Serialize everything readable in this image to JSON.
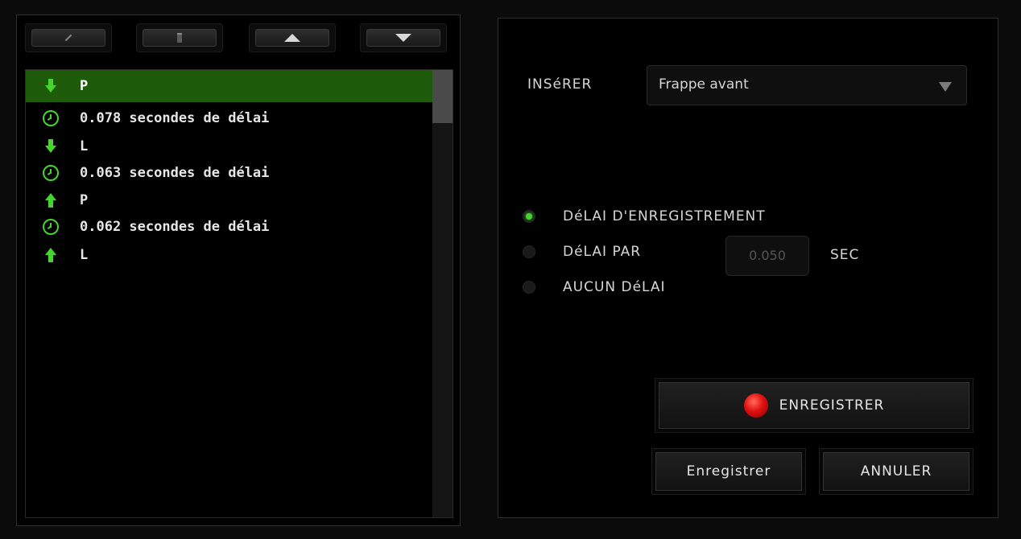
{
  "toolbar": {
    "buttons": [
      {
        "name": "edit",
        "icon": "pencil-icon"
      },
      {
        "name": "delete",
        "icon": "trash-icon"
      },
      {
        "name": "move-up",
        "icon": "arrow-up-icon"
      },
      {
        "name": "move-down",
        "icon": "arrow-down-icon"
      }
    ]
  },
  "macro_list": {
    "items": [
      {
        "icon": "key-down-arrow-icon",
        "text": "P",
        "selected": true
      },
      {
        "icon": "clock-icon",
        "text": "0.078 secondes de délai"
      },
      {
        "icon": "key-down-arrow-icon",
        "text": "L"
      },
      {
        "icon": "clock-icon",
        "text": "0.063 secondes de délai"
      },
      {
        "icon": "key-up-arrow-icon",
        "text": "P"
      },
      {
        "icon": "clock-icon",
        "text": "0.062 secondes de délai"
      },
      {
        "icon": "key-up-arrow-icon",
        "text": "L"
      }
    ]
  },
  "settings": {
    "insert_label": "INSéRER",
    "insert_value": "Frappe avant",
    "radio_options": [
      {
        "label": "DéLAI D'ENREGISTREMENT",
        "selected": true
      },
      {
        "label": "DéLAI PAR",
        "selected": false
      },
      {
        "label": "AUCUN DéLAI",
        "selected": false
      }
    ],
    "delay_value": "0.050",
    "delay_unit": "SEC",
    "record_label": "ENREGISTRER",
    "save_label": "Enregistrer",
    "cancel_label": "ANNULER"
  },
  "colors": {
    "accent": "#44d62c",
    "selected_row": "#1e5c0c",
    "record": "#e01010"
  }
}
